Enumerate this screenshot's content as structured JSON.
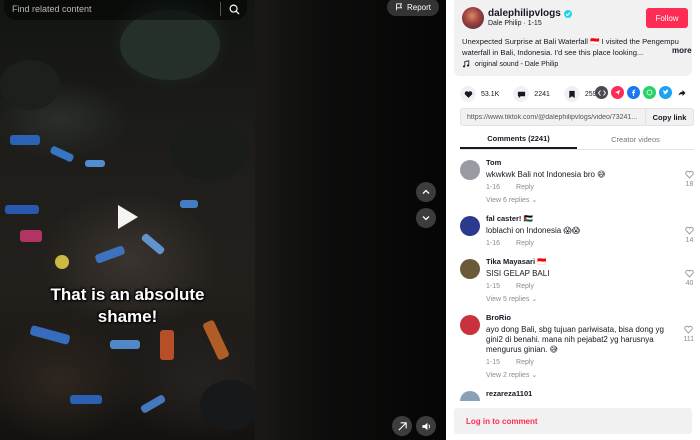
{
  "search": {
    "placeholder": "Find related content"
  },
  "video": {
    "caption": "That is an absolute shame!",
    "report_label": "Report"
  },
  "post": {
    "username": "dalephilipvlogs",
    "display_name": "Dale Philip",
    "date": "1-15",
    "follow_label": "Follow",
    "description": "Unexpected Surprise at Bali Waterfall 🇮🇩 I visited the Pengempu waterfall in Bali, Indonesia. I'd see this place looking...",
    "more_label": "more",
    "sound": "original sound - Dale Philip",
    "likes": "53.1K",
    "comments_count": "2241",
    "saves": "2597",
    "link": "https://www.tiktok.com/@dalephilipvlogs/video/73241...",
    "copy_label": "Copy link"
  },
  "tabs": [
    {
      "label": "Comments (2241)"
    },
    {
      "label": "Creator videos"
    }
  ],
  "comments": [
    {
      "user": "Tom",
      "text": "wkwkwk Bali not Indonesia bro 😅",
      "date": "1-16",
      "reply": "Reply",
      "replies": "View 6 replies",
      "likes": "18",
      "avatar_color": "#9a9aa3"
    },
    {
      "user": "fal caster! 🇵🇸",
      "text": "loblachi on Indonesia 😱😱",
      "date": "1-16",
      "reply": "Reply",
      "replies": "",
      "likes": "14",
      "avatar_color": "#2b3a8c"
    },
    {
      "user": "Tika Mayasari 🇮🇩",
      "text": "SISI GELAP BALI",
      "date": "1-15",
      "reply": "Reply",
      "replies": "View 5 replies",
      "likes": "40",
      "avatar_color": "#6b5a3a"
    },
    {
      "user": "BroRio",
      "text": "ayo dong Bali, sbg tujuan pariwisata, bisa dong yg gini2 di benahi. mana nih pejabat2 yg harusnya mengurus ginian. 😅",
      "date": "1-15",
      "reply": "Reply",
      "replies": "View 2 replies",
      "likes": "111",
      "avatar_color": "#c8323c"
    },
    {
      "user": "rezareza1101",
      "text": "",
      "date": "",
      "reply": "",
      "replies": "",
      "likes": "",
      "avatar_color": "#8aa0b8"
    }
  ],
  "login_label": "Log in to comment",
  "colors": {
    "accent": "#fe2c55",
    "verified": "#20d5ec"
  }
}
